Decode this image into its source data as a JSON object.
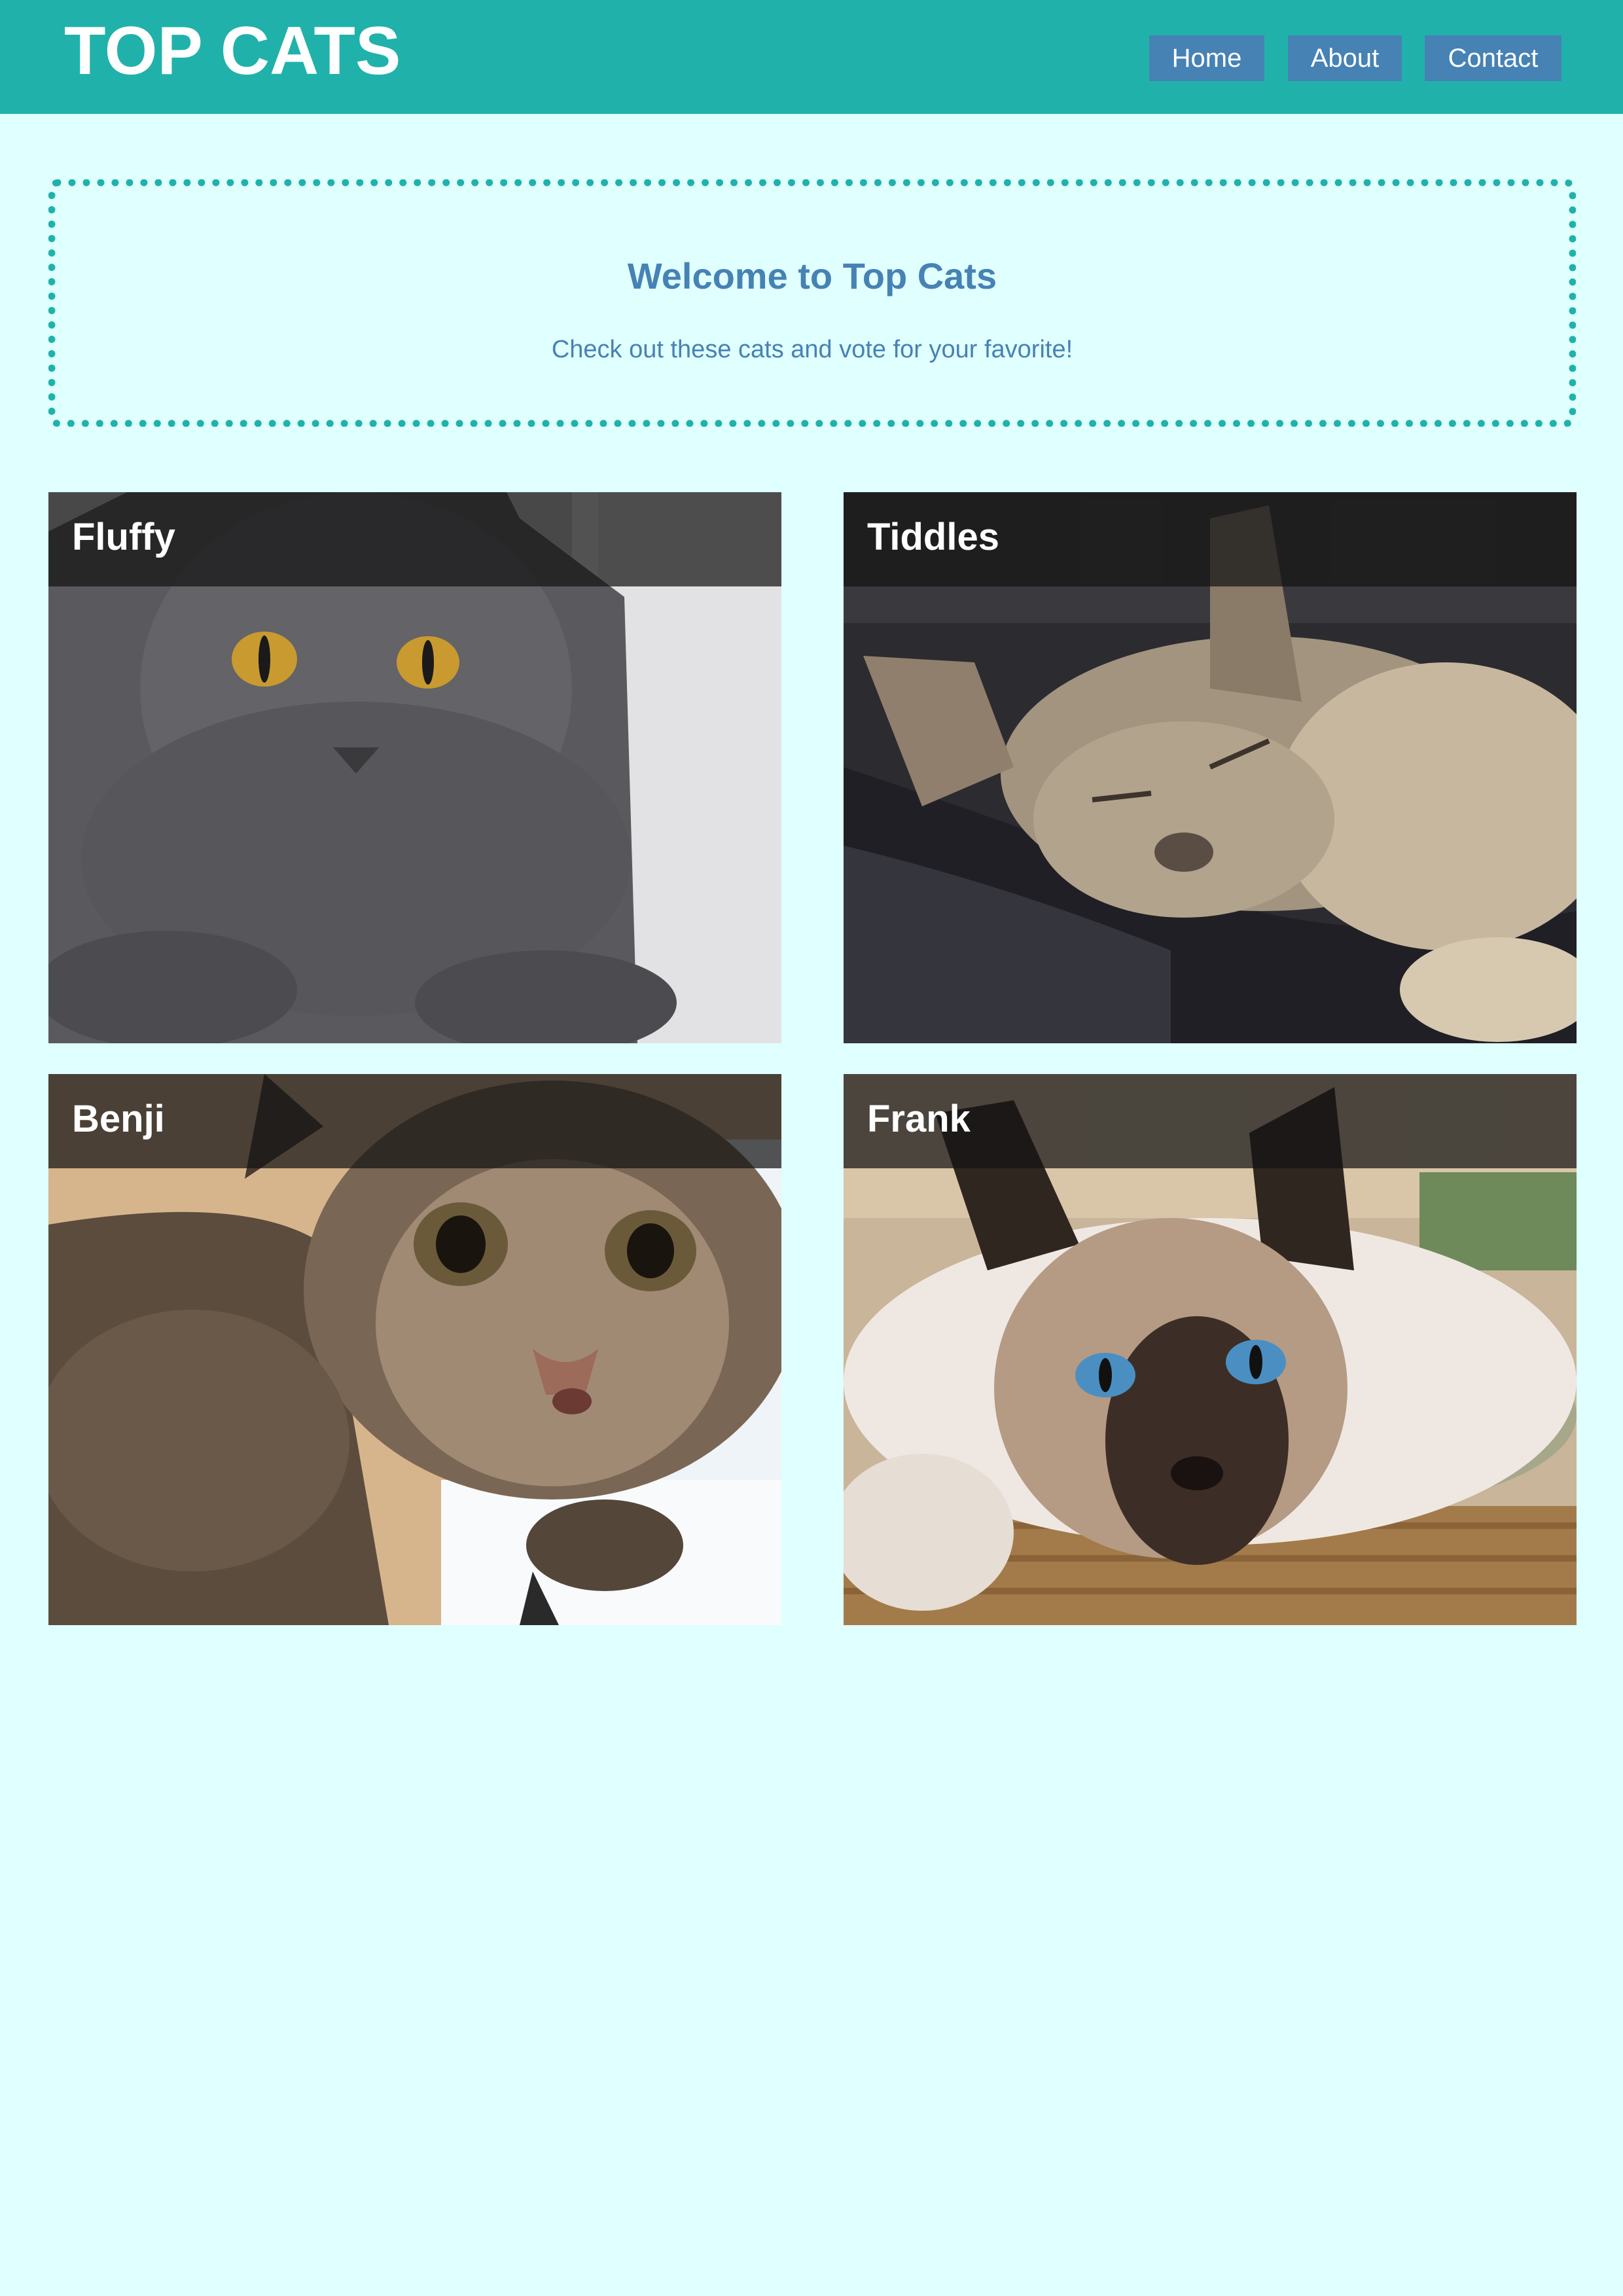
{
  "header": {
    "title": "TOP CATS",
    "nav": [
      {
        "label": "Home"
      },
      {
        "label": "About"
      },
      {
        "label": "Contact"
      }
    ]
  },
  "welcome": {
    "title": "Welcome to Top Cats",
    "subtitle": "Check out these cats and vote for your favorite!"
  },
  "cats": [
    {
      "name": "Fluffy",
      "photo": "grey-cat-photo"
    },
    {
      "name": "Tiddles",
      "photo": "sleeping-cat-photo"
    },
    {
      "name": "Benji",
      "photo": "tabby-cat-photo"
    },
    {
      "name": "Frank",
      "photo": "siamese-cat-photo"
    }
  ],
  "colors": {
    "background": "#e0ffff",
    "header": "#20b2aa",
    "nav_button": "#4682b4",
    "welcome_text": "#4682b4",
    "welcome_border": "#20b2aa"
  }
}
